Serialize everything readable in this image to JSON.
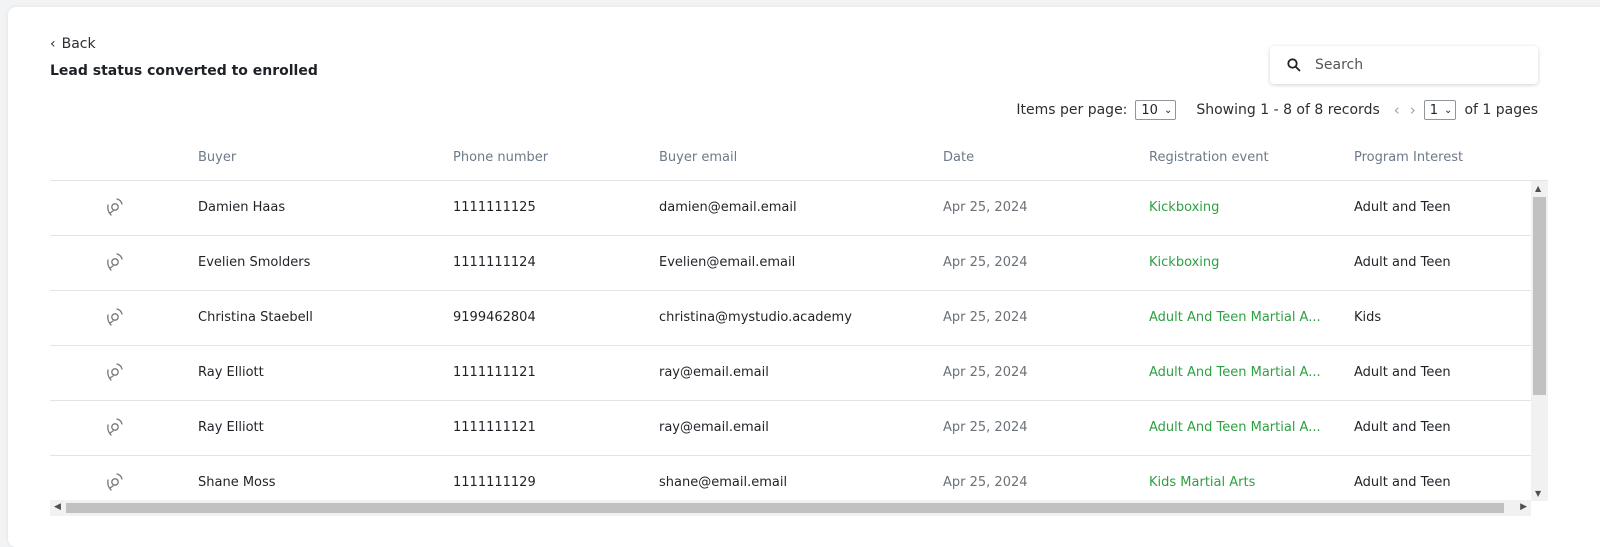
{
  "header": {
    "back_label": "Back",
    "title": "Lead status converted to enrolled"
  },
  "search": {
    "placeholder": "Search",
    "value": ""
  },
  "pager": {
    "items_per_page_label": "Items per page:",
    "items_per_page_value": "10",
    "showing_text": "Showing 1 - 8 of 8 records",
    "page_value": "1",
    "pages_suffix": "of 1 pages"
  },
  "table": {
    "columns": [
      "Buyer",
      "Phone number",
      "Buyer email",
      "Date",
      "Registration event",
      "Program Interest"
    ],
    "rows": [
      {
        "buyer": "Damien Haas",
        "phone": "1111111125",
        "email": "damien@email.email",
        "date": "Apr 25, 2024",
        "event": "Kickboxing",
        "program": "Adult and Teen"
      },
      {
        "buyer": "Evelien Smolders",
        "phone": "1111111124",
        "email": "Evelien@email.email",
        "date": "Apr 25, 2024",
        "event": "Kickboxing",
        "program": "Adult and Teen"
      },
      {
        "buyer": "Christina Staebell",
        "phone": "9199462804",
        "email": "christina@mystudio.academy",
        "date": "Apr 25, 2024",
        "event": "Adult And Teen Martial A...",
        "program": "Kids"
      },
      {
        "buyer": "Ray Elliott",
        "phone": "1111111121",
        "email": "ray@email.email",
        "date": "Apr 25, 2024",
        "event": "Adult And Teen Martial A...",
        "program": "Adult and Teen"
      },
      {
        "buyer": "Ray Elliott",
        "phone": "1111111121",
        "email": "ray@email.email",
        "date": "Apr 25, 2024",
        "event": "Adult And Teen Martial A...",
        "program": "Adult and Teen"
      },
      {
        "buyer": "Shane Moss",
        "phone": "1111111129",
        "email": "shane@email.email",
        "date": "Apr 25, 2024",
        "event": "Kids Martial Arts",
        "program": "Adult and Teen"
      }
    ]
  },
  "colors": {
    "event_green": "#2ea043",
    "header_gray": "#6c7a89",
    "date_gray": "#6b7178"
  },
  "icons": {
    "row_icon": "phone-call-icon",
    "search": "search-icon",
    "back": "chevron-left-icon"
  }
}
